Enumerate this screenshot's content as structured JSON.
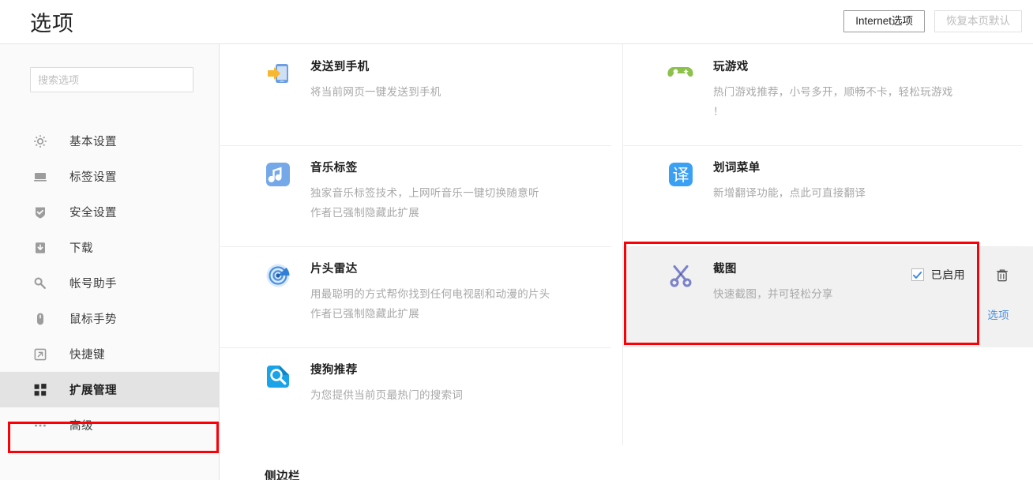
{
  "header": {
    "title": "选项",
    "buttons": [
      {
        "label": "Internet选项",
        "state": "enabled"
      },
      {
        "label": "恢复本页默认",
        "state": "disabled"
      }
    ]
  },
  "sidebar": {
    "search": {
      "value": "",
      "placeholder": "搜索选项"
    },
    "items": [
      {
        "label": "基本设置",
        "icon": "gear-icon",
        "active": false
      },
      {
        "label": "标签设置",
        "icon": "monitor-icon",
        "active": false
      },
      {
        "label": "安全设置",
        "icon": "shield-check-icon",
        "active": false
      },
      {
        "label": "下载",
        "icon": "download-icon",
        "active": false
      },
      {
        "label": "帐号助手",
        "icon": "key-icon",
        "active": false
      },
      {
        "label": "鼠标手势",
        "icon": "mouse-icon",
        "active": false
      },
      {
        "label": "快捷键",
        "icon": "arrow-out-icon",
        "active": false
      },
      {
        "label": "扩展管理",
        "icon": "grid-squares-icon",
        "active": true
      },
      {
        "label": "高级",
        "icon": "ellipsis-icon",
        "active": false
      }
    ]
  },
  "main": {
    "extensions_left": [
      {
        "name": "发送到手机",
        "desc1": "将当前网页一键发送到手机",
        "desc2": "",
        "icon": "send-to-phone-icon"
      },
      {
        "name": "音乐标签",
        "desc1": "独家音乐标签技术，上网听音乐一键切换随意听",
        "desc2": "作者已强制隐藏此扩展",
        "icon": "music-note-icon"
      },
      {
        "name": "片头雷达",
        "desc1": "用最聪明的方式帮你找到任何电视剧和动漫的片头",
        "desc2": "作者已强制隐藏此扩展",
        "icon": "radar-icon"
      },
      {
        "name": "搜狗推荐",
        "desc1": "为您提供当前页最热门的搜索词",
        "desc2": "",
        "icon": "search-recommend-icon"
      }
    ],
    "extensions_right": [
      {
        "name": "玩游戏",
        "desc1": "热门游戏推荐，小号多开，顺畅不卡，轻松玩游戏",
        "desc2": "！",
        "icon": "gamepad-icon"
      },
      {
        "name": "划词菜单",
        "desc1": "新增翻译功能，点此可直接翻译",
        "desc2": "",
        "icon": "translate-icon"
      },
      {
        "name": "截图",
        "desc1": "快速截图，并可轻松分享",
        "desc2": "",
        "icon": "scissors-icon",
        "enabled_label": "已启用",
        "enabled_checked": true,
        "options_link": "选项",
        "delete_icon": "trash-icon",
        "highlighted": true
      }
    ],
    "section_heading": "侧边栏"
  },
  "colors": {
    "highlight_box": "#fb0007",
    "link": "#4a90e2",
    "checkbox_check": "#4a90e2",
    "active_nav_bg": "#e3e3e3",
    "hover_card_bg": "#f1f1f1"
  }
}
